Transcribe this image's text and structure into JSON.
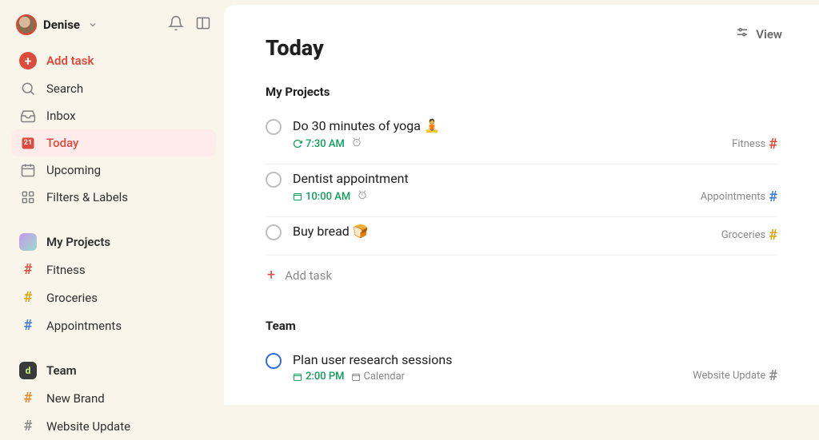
{
  "user": {
    "name": "Denise"
  },
  "sidebar": {
    "add": "Add task",
    "items": [
      {
        "label": "Search"
      },
      {
        "label": "Inbox"
      },
      {
        "label": "Today",
        "active": true,
        "day": "21"
      },
      {
        "label": "Upcoming"
      },
      {
        "label": "Filters & Labels"
      }
    ],
    "projects_section": "My Projects",
    "projects": [
      {
        "label": "Fitness",
        "hash": "red"
      },
      {
        "label": "Groceries",
        "hash": "gold"
      },
      {
        "label": "Appointments",
        "hash": "blue"
      }
    ],
    "team_section": "Team",
    "team": [
      {
        "label": "New Brand",
        "hash": "orange"
      },
      {
        "label": "Website Update",
        "hash": "grey"
      }
    ]
  },
  "main": {
    "view": "View",
    "title": "Today",
    "group1": {
      "title": "My Projects",
      "tasks": [
        {
          "name": "Do 30 minutes of yoga 🧘",
          "time": "7:30 AM",
          "recurring": true,
          "alarm": true,
          "tag": "Fitness",
          "tag_hash": "red"
        },
        {
          "name": "Dentist appointment",
          "time": "10:00 AM",
          "recurring": false,
          "alarm": true,
          "tag": "Appointments",
          "tag_hash": "blue"
        },
        {
          "name": "Buy bread 🍞",
          "time": "",
          "recurring": false,
          "alarm": false,
          "tag": "Groceries",
          "tag_hash": "gold"
        }
      ],
      "add": "Add task"
    },
    "group2": {
      "title": "Team",
      "tasks": [
        {
          "name": "Plan user research sessions",
          "time": "2:00 PM",
          "calendar": "Calendar",
          "tag": "Website Update",
          "tag_hash": "grey",
          "circle": "blue"
        }
      ]
    }
  }
}
